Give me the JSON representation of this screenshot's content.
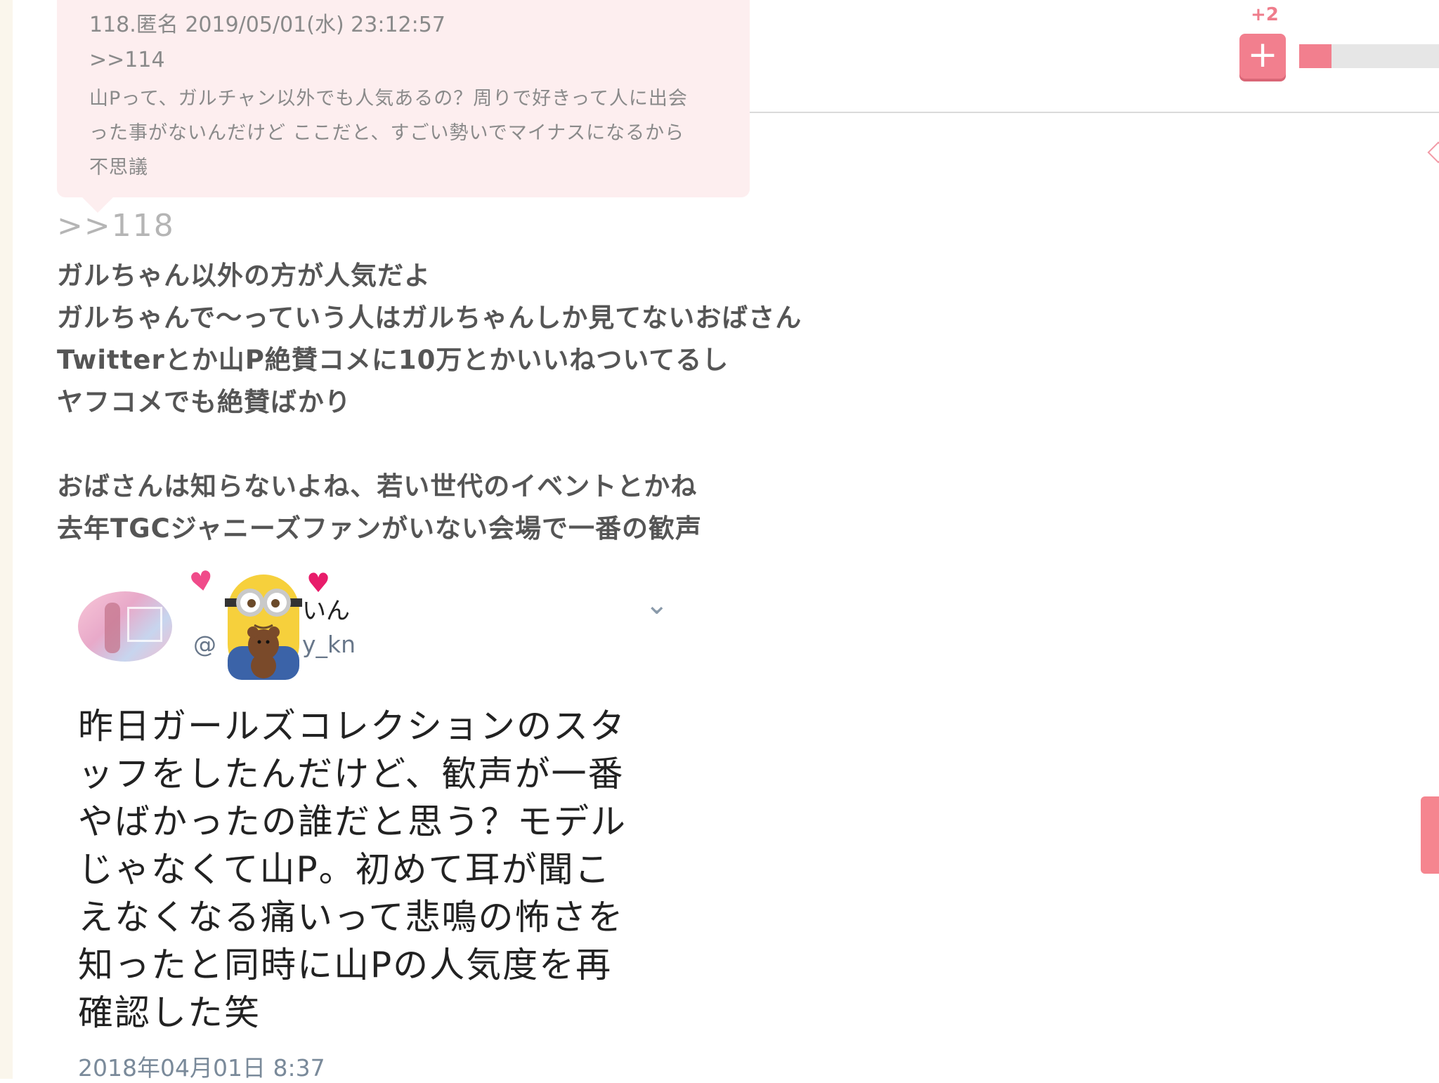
{
  "quote": {
    "meta": "118.匿名 2019/05/01(水) 23:12:57",
    "anchor": ">>114",
    "lines": [
      "山Pって、ガルチャン以外でも人気あるの？周りで好きって人に出会",
      "った事がないんだけど ここだと、すごい勢いでマイナスになるから",
      "不思議"
    ]
  },
  "vote": {
    "count": "+2",
    "plus_label": "+",
    "ratio": 0.23,
    "accent": "#f27f8e"
  },
  "reply": {
    "anchor": ">>118",
    "lines": [
      "ガルちゃん以外の方が人気だよ",
      "ガルちゃんで〜っていう人はガルちゃんしか見てないおばさん",
      "Twitterとか山P絶賛コメに10万とかいいねついてるし",
      "ヤフコメでも絶賛ばかり",
      "",
      "おばさんは知らないよね、若い世代のイベントとかね",
      "去年TGCジャニーズファンがいない会場で一番の歓声"
    ]
  },
  "tweet": {
    "name_visible": "いん",
    "handle_prefix": "@",
    "handle_suffix": "y_kn",
    "chevron": "⌄",
    "lines": [
      "昨日ガールズコレクションのスタ",
      "ッフをしたんだけど、歓声が一番",
      "やばかったの誰だと思う？モデル",
      "じゃなくて山P。初めて耳が聞こ",
      "えなくなる痛いって悲鳴の怖さを",
      "知ったと同時に山Pの人気度を再",
      "確認した笑"
    ],
    "date": "2018年04月01日 8:37"
  }
}
